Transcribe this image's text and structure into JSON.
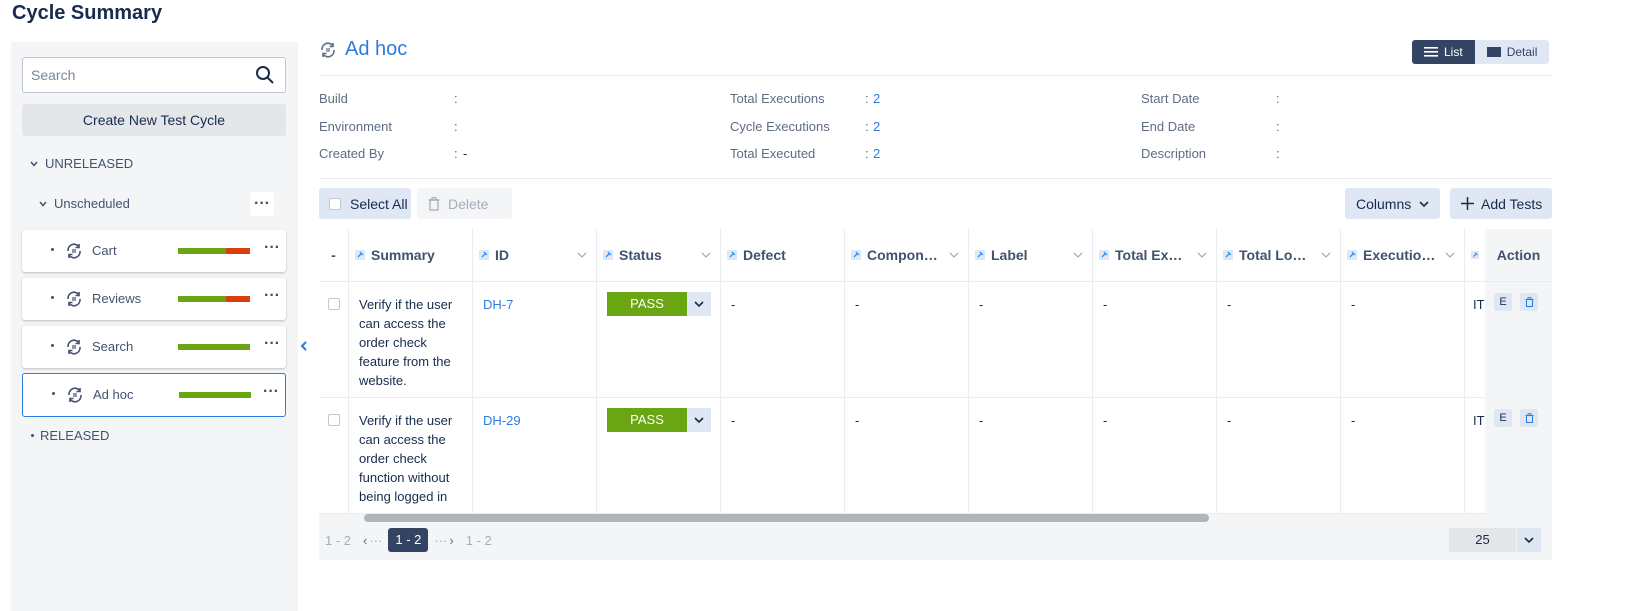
{
  "page": {
    "title": "Cycle Summary"
  },
  "sidebar": {
    "search_placeholder": "Search",
    "create_label": "Create New Test Cycle",
    "unreleased_label": "UNRELEASED",
    "unscheduled_label": "Unscheduled",
    "released_label": "RELEASED",
    "cycles": [
      {
        "name": "Cart",
        "pass_fraction": 0.66,
        "fail_fraction": 0.34,
        "active": false
      },
      {
        "name": "Reviews",
        "pass_fraction": 0.66,
        "fail_fraction": 0.34,
        "active": false
      },
      {
        "name": "Search",
        "pass_fraction": 1.0,
        "fail_fraction": 0.0,
        "active": false
      },
      {
        "name": "Ad hoc",
        "pass_fraction": 1.0,
        "fail_fraction": 0.0,
        "active": true
      }
    ]
  },
  "main": {
    "title": "Ad hoc",
    "view_list": "List",
    "view_detail": "Detail",
    "meta": {
      "build_label": "Build",
      "build_value": "",
      "environment_label": "Environment",
      "environment_value": "",
      "created_by_label": "Created By",
      "created_by_value": "-",
      "total_executions_label": "Total Executions",
      "total_executions_value": "2",
      "cycle_executions_label": "Cycle Executions",
      "cycle_executions_value": "2",
      "total_executed_label": "Total Executed",
      "total_executed_value": "2",
      "start_date_label": "Start Date",
      "start_date_value": "",
      "end_date_label": "End Date",
      "end_date_value": "",
      "description_label": "Description",
      "description_value": "",
      "colon": ":"
    },
    "actions": {
      "select_all": "Select All",
      "delete": "Delete",
      "columns": "Columns",
      "add_tests": "Add Tests"
    },
    "table": {
      "dash_header": "-",
      "headers": [
        "Summary",
        "ID",
        "Status",
        "Defect",
        "Compon…",
        "Label",
        "Total Ex…",
        "Total Lo…",
        "Executio…"
      ],
      "action_header": "Action",
      "rows": [
        {
          "summary": [
            "Verify if the user",
            "can access the",
            "order check",
            "feature from the",
            "website."
          ],
          "id": "DH-7",
          "status": "PASS",
          "defect": "-",
          "component": "-",
          "label": "-",
          "total_ex": "-",
          "total_lo": "-",
          "execution": "-",
          "extra": "IT"
        },
        {
          "summary": [
            "Verify if the user",
            "can access the",
            "order check",
            "function without",
            "being logged in"
          ],
          "id": "DH-29",
          "status": "PASS",
          "defect": "-",
          "component": "-",
          "label": "-",
          "total_ex": "-",
          "total_lo": "-",
          "execution": "-",
          "extra": "IT"
        }
      ],
      "edit_icon_text": "E"
    },
    "pagination": {
      "range_left": "1 - 2",
      "ellipsis_left": "···",
      "current": "1 - 2",
      "ellipsis_right": "···",
      "range_right": "1 - 2",
      "page_size": "25"
    }
  },
  "colors": {
    "accent": "#2a7dde",
    "pass": "#6aa513",
    "fail": "#d93e12",
    "dark_button": "#344563"
  }
}
